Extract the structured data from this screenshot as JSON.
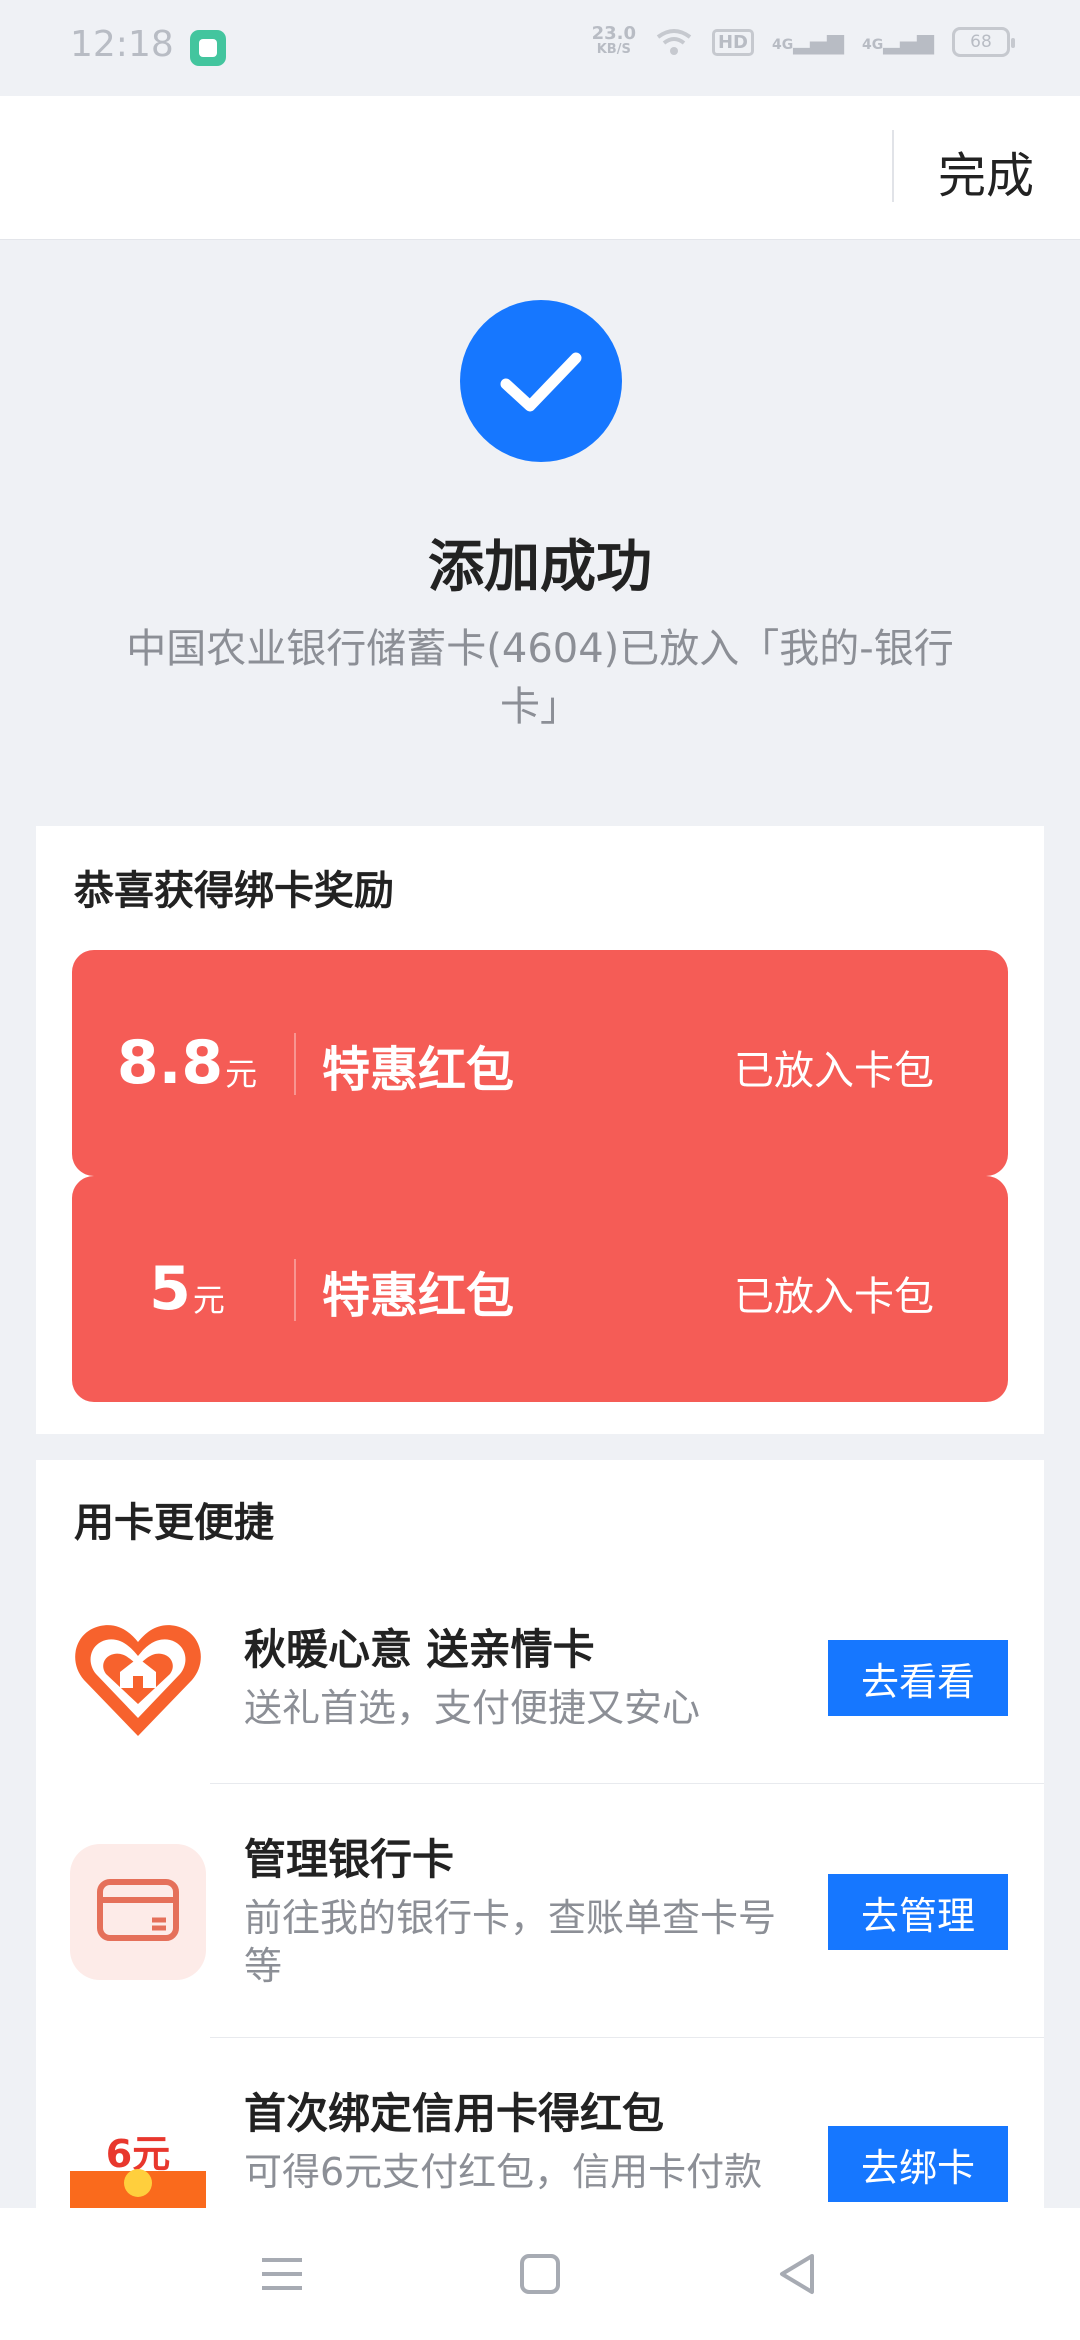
{
  "status_bar": {
    "time": "12:18",
    "net_speed_value": "23.0",
    "net_speed_unit": "KB/S",
    "hd": "HD",
    "sim1": "4G",
    "sim2": "4G",
    "battery": "68"
  },
  "header": {
    "done_label": "完成"
  },
  "success": {
    "title": "添加成功",
    "description": "中国农业银行储蓄卡(4604)已放入「我的-银行卡」"
  },
  "reward": {
    "title": "恭喜获得绑卡奖励",
    "coupons": [
      {
        "value": "8.8",
        "unit": "元",
        "name": "特惠红包",
        "status": "已放入卡包"
      },
      {
        "value": "5",
        "unit": "元",
        "name": "特惠红包",
        "status": "已放入卡包"
      }
    ]
  },
  "services": {
    "title": "用卡更便捷",
    "items": [
      {
        "title": "秋暖心意 送亲情卡",
        "subtitle": "送礼首选，支付便捷又安心",
        "button": "去看看",
        "icon": "heart-house-icon"
      },
      {
        "title": "管理银行卡",
        "subtitle": "前往我的银行卡，查账单查卡号等",
        "button": "去管理",
        "icon": "bank-card-icon"
      },
      {
        "title": "首次绑定信用卡得红包",
        "subtitle": "可得6元支付红包，信用卡付款",
        "button": "去绑卡",
        "icon": "red-packet-icon",
        "icon_text": "6元"
      }
    ]
  },
  "colors": {
    "accent": "#1677ff",
    "coupon": "#f55c56",
    "background": "#eff1f5"
  }
}
